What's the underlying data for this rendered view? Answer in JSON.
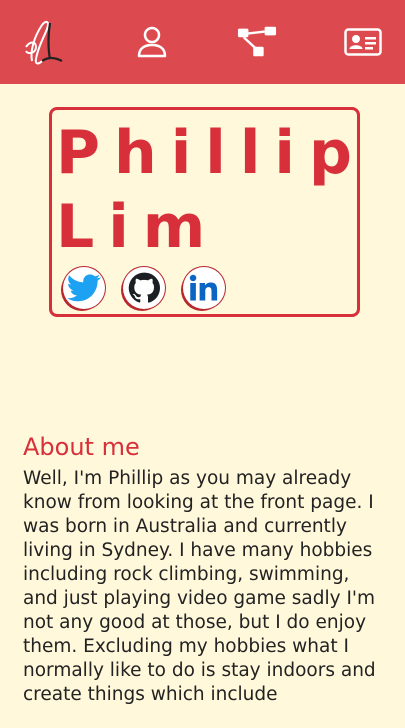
{
  "nav": {
    "logo_icon": "pl-signature-logo",
    "items": [
      {
        "icon": "user-icon"
      },
      {
        "icon": "sitemap-icon"
      },
      {
        "icon": "id-card-icon"
      }
    ]
  },
  "hero": {
    "name_line1": "Phillip",
    "name_line2": "Lim",
    "socials": [
      {
        "icon": "twitter-icon"
      },
      {
        "icon": "github-icon"
      },
      {
        "icon": "linkedin-icon"
      }
    ]
  },
  "about": {
    "heading": "About me",
    "body": "Well, I'm Phillip as you may already know from looking at the front page. I was born in Australia and currently living in Sydney. I have many hobbies including rock climbing, swimming, and just playing video game sadly I'm not any good at those, but I do enjoy them. Excluding my hobbies what I normally like to do is stay indoors and create things which include"
  },
  "colors": {
    "navbar": "#dc4a4f",
    "accent": "#d8303a",
    "background": "#fff8db",
    "twitter": "#1da1f2",
    "linkedin": "#0a66c2"
  }
}
